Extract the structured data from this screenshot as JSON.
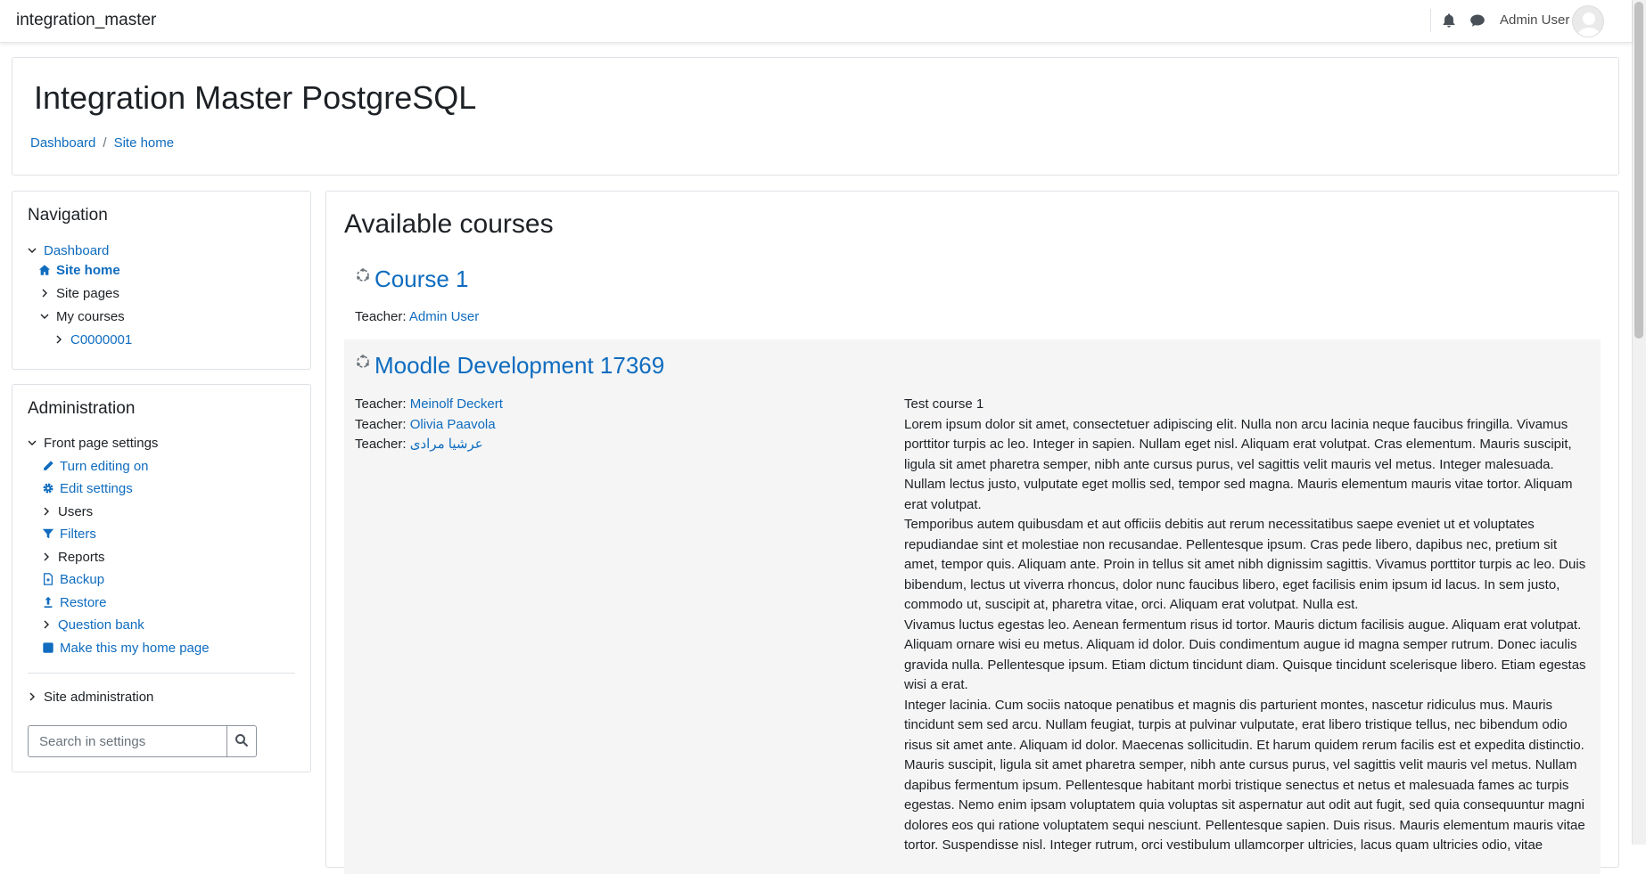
{
  "navbar": {
    "brand": "integration_master",
    "user_name": "Admin User",
    "icons": [
      "bell-icon",
      "chat-icon"
    ]
  },
  "header": {
    "title": "Integration Master PostgreSQL",
    "breadcrumb": [
      "Dashboard",
      "Site home"
    ]
  },
  "navigation_block": {
    "title": "Navigation",
    "items": [
      {
        "label": "Dashboard"
      },
      {
        "label": "Site home"
      },
      {
        "label": "Site pages"
      },
      {
        "label": "My courses"
      },
      {
        "label": "C0000001"
      }
    ]
  },
  "admin_block": {
    "title": "Administration",
    "items": [
      {
        "label": "Front page settings"
      },
      {
        "label": "Turn editing on"
      },
      {
        "label": "Edit settings"
      },
      {
        "label": "Users"
      },
      {
        "label": "Filters"
      },
      {
        "label": "Reports"
      },
      {
        "label": "Backup"
      },
      {
        "label": "Restore"
      },
      {
        "label": "Question bank"
      },
      {
        "label": "Make this my home page"
      },
      {
        "label": "Site administration"
      }
    ],
    "search_placeholder": "Search in settings"
  },
  "main": {
    "heading": "Available courses",
    "teacher_label": "Teacher:",
    "courses": [
      {
        "name": "Course 1",
        "teachers": [
          "Admin User"
        ]
      },
      {
        "name": "Moodle Development 17369",
        "teachers": [
          "Meinolf Deckert",
          "Olivia Paavola",
          "عرشیا مرادی"
        ],
        "summary": [
          "Test course 1",
          "Lorem ipsum dolor sit amet, consectetuer adipiscing elit. Nulla non arcu lacinia neque faucibus fringilla. Vivamus porttitor turpis ac leo. Integer in sapien. Nullam eget nisl. Aliquam erat volutpat. Cras elementum. Mauris suscipit, ligula sit amet pharetra semper, nibh ante cursus purus, vel sagittis velit mauris vel metus. Integer malesuada. Nullam lectus justo, vulputate eget mollis sed, tempor sed magna. Mauris elementum mauris vitae tortor. Aliquam erat volutpat.",
          "Temporibus autem quibusdam et aut officiis debitis aut rerum necessitatibus saepe eveniet ut et voluptates repudiandae sint et molestiae non recusandae. Pellentesque ipsum. Cras pede libero, dapibus nec, pretium sit amet, tempor quis. Aliquam ante. Proin in tellus sit amet nibh dignissim sagittis. Vivamus porttitor turpis ac leo. Duis bibendum, lectus ut viverra rhoncus, dolor nunc faucibus libero, eget facilisis enim ipsum id lacus. In sem justo, commodo ut, suscipit at, pharetra vitae, orci. Aliquam erat volutpat. Nulla est.",
          "Vivamus luctus egestas leo. Aenean fermentum risus id tortor. Mauris dictum facilisis augue. Aliquam erat volutpat. Aliquam ornare wisi eu metus. Aliquam id dolor. Duis condimentum augue id magna semper rutrum. Donec iaculis gravida nulla. Pellentesque ipsum. Etiam dictum tincidunt diam. Quisque tincidunt scelerisque libero. Etiam egestas wisi a erat.",
          "Integer lacinia. Cum sociis natoque penatibus et magnis dis parturient montes, nascetur ridiculus mus. Mauris tincidunt sem sed arcu. Nullam feugiat, turpis at pulvinar vulputate, erat libero tristique tellus, nec bibendum odio risus sit amet ante. Aliquam id dolor. Maecenas sollicitudin. Et harum quidem rerum facilis est et expedita distinctio. Mauris suscipit, ligula sit amet pharetra semper, nibh ante cursus purus, vel sagittis velit mauris vel metus. Nullam dapibus fermentum ipsum. Pellentesque habitant morbi tristique senectus et netus et malesuada fames ac turpis egestas. Nemo enim ipsam voluptatem quia voluptas sit aspernatur aut odit aut fugit, sed quia consequuntur magni dolores eos qui ratione voluptatem sequi nesciunt. Pellentesque sapien. Duis risus. Mauris elementum mauris vitae tortor. Suspendisse nisl. Integer rutrum, orci vestibulum ullamcorper ultricies, lacus quam ultricies odio, vitae"
        ]
      }
    ]
  },
  "colors": {
    "link": "#0f6cbf",
    "text": "#1d2125",
    "border": "#dee2e6",
    "course_bg": "#f5f5f5"
  }
}
